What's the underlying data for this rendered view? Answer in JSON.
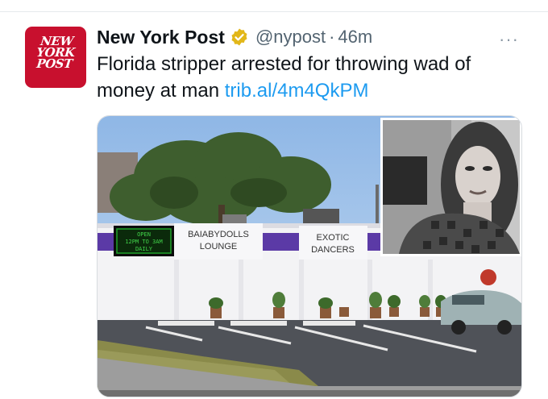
{
  "tweet": {
    "avatar_text": "NEW\nYORK\nPOST",
    "author_name": "New York Post",
    "handle": "@nypost",
    "separator": "·",
    "time": "46m",
    "more": "···",
    "text": "Florida stripper arrested for throwing wad of money at man ",
    "link": "trib.al/4m4QkPM"
  },
  "media": {
    "sign_left": "BAIABYDOLLS",
    "sign_left_2": "LOUNGE",
    "sign_right": "EXOTIC",
    "sign_right_2": "DANCERS",
    "led_line1": "OPEN",
    "led_line2": "12PM TO 3AM",
    "led_line3": "DAILY"
  },
  "colors": {
    "accent_link": "#1d9bf0",
    "brand_red": "#c8102e",
    "verified_gold": "#e2b719"
  }
}
